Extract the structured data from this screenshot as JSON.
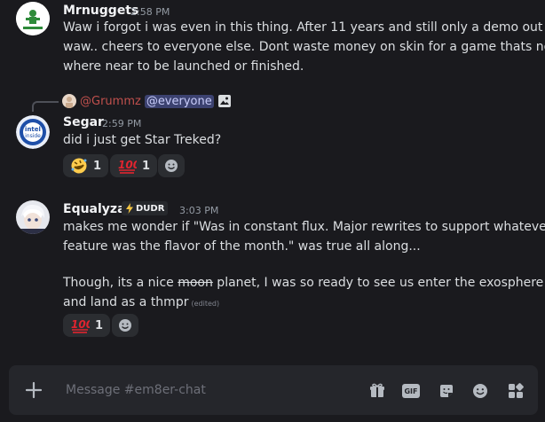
{
  "messages": [
    {
      "author": "Mrnuggets",
      "time": "2:58 PM",
      "lines": [
        "Waw i forgot i was even in this thing. After 11 years and still only a demo out",
        "waw.. cheers to everyone else. Dont waste money on skin for a game thats no",
        "where near to be launched or finished."
      ]
    },
    {
      "reply": {
        "name": "@Grummz",
        "mention": "@everyone"
      },
      "author": "Segar",
      "time": "2:59 PM",
      "lines": [
        "did i just get Star Treked?"
      ],
      "reactions": [
        {
          "emoji": "rofl",
          "count": "1"
        },
        {
          "emoji": "hundred",
          "count": "1"
        }
      ]
    },
    {
      "author": "Equalyzar",
      "badge": "DUDR",
      "time": "3:03 PM",
      "lines": [
        "makes me wonder if \"Was in constant flux. Major rewrites to support whatever",
        "feature was the flavor of the month.\" was true all along...",
        "",
        "Though, its a nice ",
        "moon",
        " planet, I was so ready to see us enter the exosphere",
        "and land as a thmpr"
      ],
      "edited": "(edited)",
      "reactions": [
        {
          "emoji": "hundred",
          "count": "1"
        }
      ]
    }
  ],
  "composer": {
    "placeholder": "Message #em8er-chat",
    "gif_label": "GIF"
  },
  "colors": {
    "background": "#1a1a1e",
    "reply_name": "#c0504d",
    "mention_bg": "#3c4270",
    "hundred_red": "#e0242f"
  }
}
